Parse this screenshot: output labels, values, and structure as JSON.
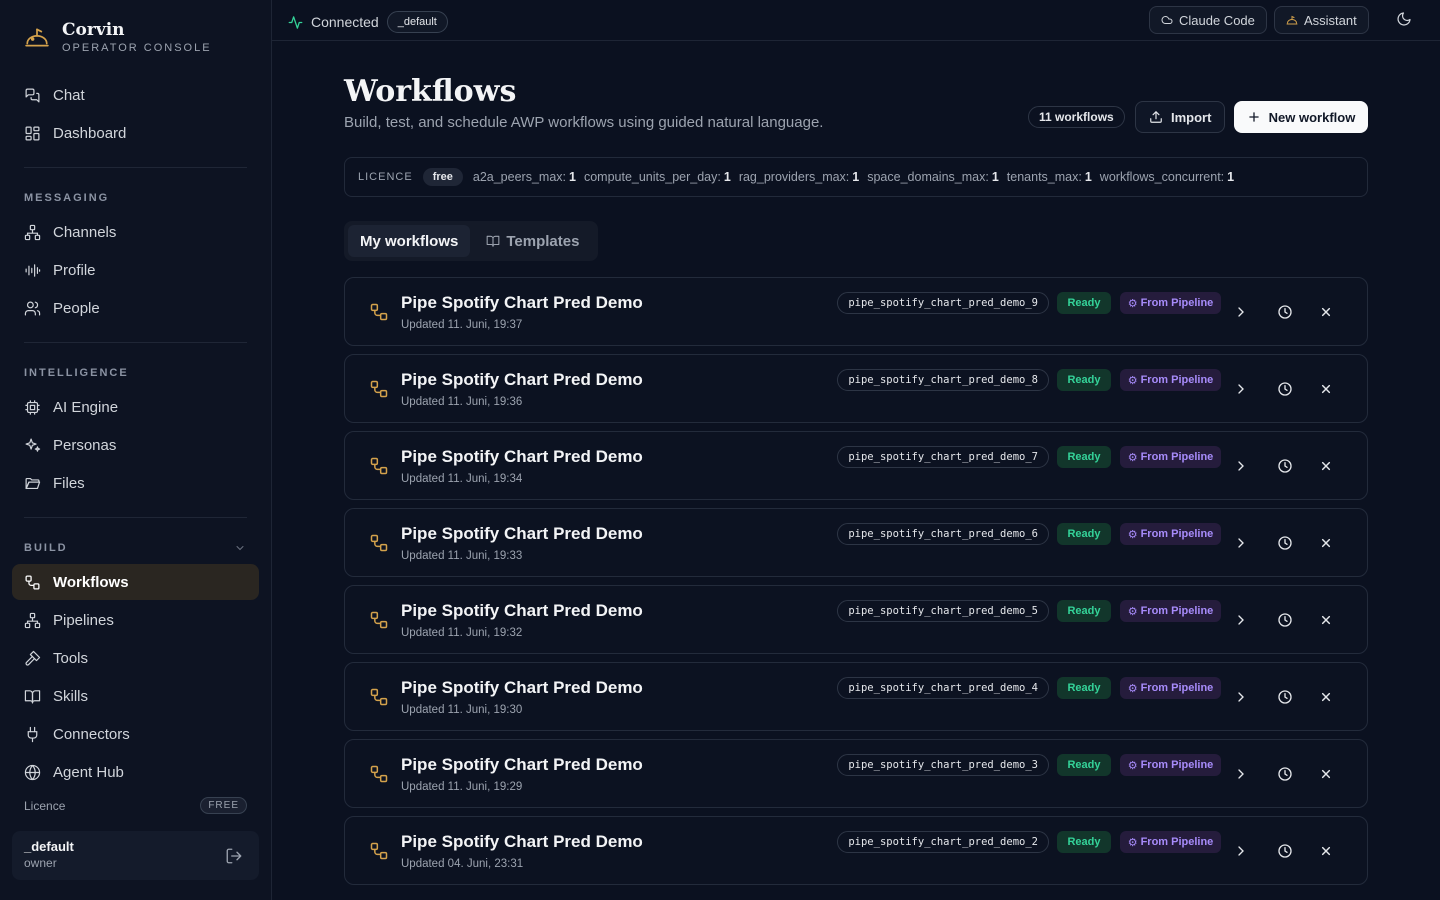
{
  "brand": {
    "name": "Corvin",
    "subtitle": "OPERATOR CONSOLE"
  },
  "sidebar": {
    "top_items": [
      {
        "label": "Chat",
        "icon": "chat-icon"
      },
      {
        "label": "Dashboard",
        "icon": "dashboard-icon"
      }
    ],
    "sections": [
      {
        "label": "MESSAGING",
        "items": [
          {
            "label": "Channels",
            "icon": "channels-icon"
          },
          {
            "label": "Profile",
            "icon": "waveform-icon"
          },
          {
            "label": "People",
            "icon": "people-icon"
          }
        ]
      },
      {
        "label": "INTELLIGENCE",
        "items": [
          {
            "label": "AI Engine",
            "icon": "cpu-icon"
          },
          {
            "label": "Personas",
            "icon": "sparkles-icon"
          },
          {
            "label": "Files",
            "icon": "folder-icon"
          }
        ]
      },
      {
        "label": "BUILD",
        "items": [
          {
            "label": "Workflows",
            "icon": "workflow-icon",
            "active": true
          },
          {
            "label": "Pipelines",
            "icon": "pipelines-icon"
          },
          {
            "label": "Tools",
            "icon": "hammer-icon"
          },
          {
            "label": "Skills",
            "icon": "book-icon"
          },
          {
            "label": "Connectors",
            "icon": "plug-icon"
          },
          {
            "label": "Agent Hub",
            "icon": "globe-icon"
          }
        ]
      }
    ],
    "licence_label": "Licence",
    "licence_badge": "FREE",
    "user": {
      "name": "_default",
      "role": "owner"
    }
  },
  "topbar": {
    "status": "Connected",
    "tenant": "_default",
    "claude_code_label": "Claude Code",
    "assistant_label": "Assistant"
  },
  "main": {
    "title": "Workflows",
    "subtitle": "Build, test, and schedule AWP workflows using guided natural language.",
    "count_label": "11 workflows",
    "import_label": "Import",
    "new_label": "New workflow",
    "licence": {
      "label": "LICENCE",
      "tier": "free",
      "limits": [
        {
          "key": "a2a_peers_max:",
          "value": "1"
        },
        {
          "key": "compute_units_per_day:",
          "value": "1"
        },
        {
          "key": "rag_providers_max:",
          "value": "1"
        },
        {
          "key": "space_domains_max:",
          "value": "1"
        },
        {
          "key": "tenants_max:",
          "value": "1"
        },
        {
          "key": "workflows_concurrent:",
          "value": "1"
        }
      ]
    },
    "tabs": [
      {
        "label": "My workflows",
        "active": true
      },
      {
        "label": "Templates",
        "active": false
      }
    ],
    "workflows": [
      {
        "title": "Pipe Spotify Chart Pred Demo",
        "updated": "Updated 11. Juni, 19:37",
        "slug": "pipe_spotify_chart_pred_demo_9",
        "status": "Ready",
        "source": "From Pipeline"
      },
      {
        "title": "Pipe Spotify Chart Pred Demo",
        "updated": "Updated 11. Juni, 19:36",
        "slug": "pipe_spotify_chart_pred_demo_8",
        "status": "Ready",
        "source": "From Pipeline"
      },
      {
        "title": "Pipe Spotify Chart Pred Demo",
        "updated": "Updated 11. Juni, 19:34",
        "slug": "pipe_spotify_chart_pred_demo_7",
        "status": "Ready",
        "source": "From Pipeline"
      },
      {
        "title": "Pipe Spotify Chart Pred Demo",
        "updated": "Updated 11. Juni, 19:33",
        "slug": "pipe_spotify_chart_pred_demo_6",
        "status": "Ready",
        "source": "From Pipeline"
      },
      {
        "title": "Pipe Spotify Chart Pred Demo",
        "updated": "Updated 11. Juni, 19:32",
        "slug": "pipe_spotify_chart_pred_demo_5",
        "status": "Ready",
        "source": "From Pipeline"
      },
      {
        "title": "Pipe Spotify Chart Pred Demo",
        "updated": "Updated 11. Juni, 19:30",
        "slug": "pipe_spotify_chart_pred_demo_4",
        "status": "Ready",
        "source": "From Pipeline"
      },
      {
        "title": "Pipe Spotify Chart Pred Demo",
        "updated": "Updated 11. Juni, 19:29",
        "slug": "pipe_spotify_chart_pred_demo_3",
        "status": "Ready",
        "source": "From Pipeline"
      },
      {
        "title": "Pipe Spotify Chart Pred Demo",
        "updated": "Updated 04. Juni, 23:31",
        "slug": "pipe_spotify_chart_pred_demo_2",
        "status": "Ready",
        "source": "From Pipeline"
      }
    ]
  },
  "colors": {
    "accent": "#d4a24c",
    "ready": "#34d399",
    "pipeline": "#a78bfa",
    "active_nav": "#2a2621"
  }
}
